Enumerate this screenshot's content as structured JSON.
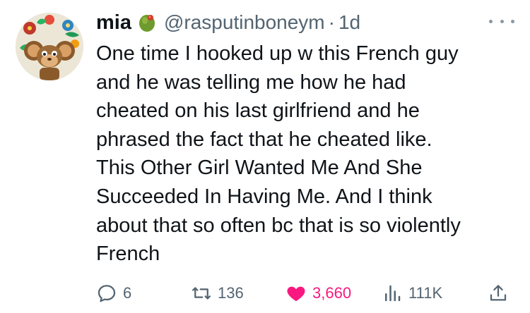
{
  "user": {
    "display_name": "mia",
    "handle": "@rasputinboneym",
    "separator": "·",
    "timestamp": "1d",
    "name_emoji": "olive-icon"
  },
  "tweet": {
    "lines": [
      "One time I hooked up w this French guy",
      "and he was telling me how he had",
      "cheated on his last girlfriend and he",
      "phrased the fact that he cheated like.",
      "This Other Girl Wanted Me And She",
      "Succeeded In Having Me. And I think",
      "about that so often bc that is so violently",
      "French"
    ]
  },
  "actions": {
    "replies": "6",
    "reposts": "136",
    "likes": "3,660",
    "views": "111K"
  },
  "colors": {
    "text": "#0f1419",
    "muted": "#536471",
    "like": "#f91880"
  }
}
